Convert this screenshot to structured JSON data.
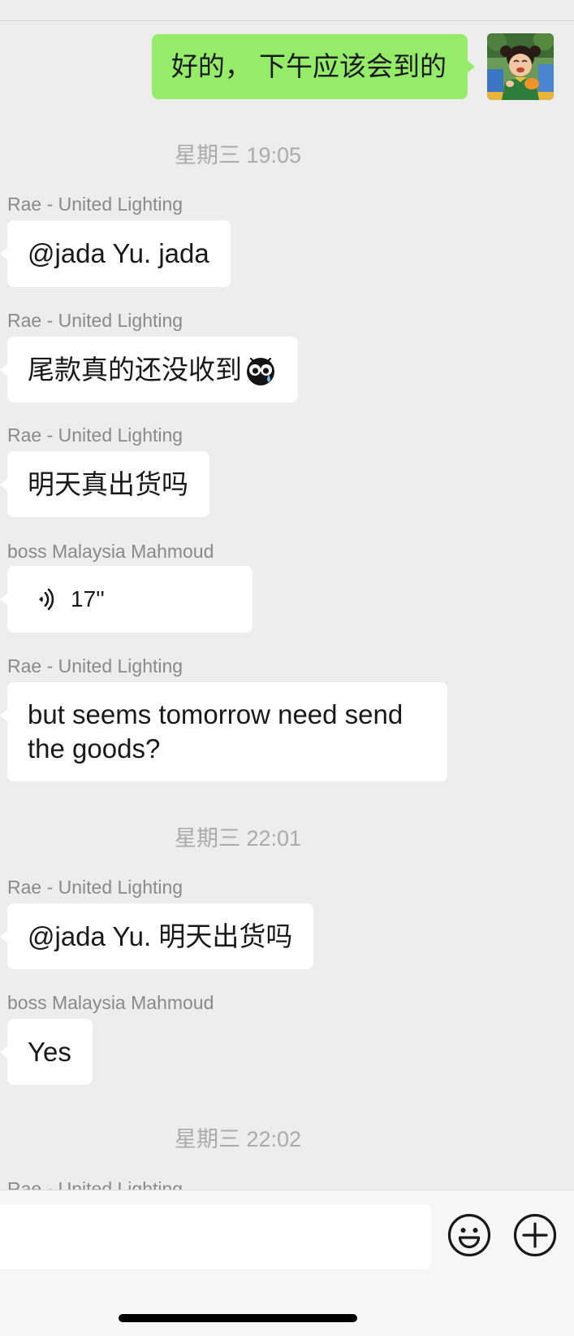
{
  "colors": {
    "chat_background": "#ededed",
    "outgoing_bubble": "#95ec69",
    "incoming_bubble": "#ffffff",
    "sender_name": "#8a8a8a",
    "timestamp": "#ababab"
  },
  "messages": [
    {
      "text": "好的， 下午应该会到的",
      "avatar_icon": "user-avatar"
    },
    {
      "timestamp": "星期三 19:05"
    },
    {
      "sender": "Rae - United Lighting",
      "text": "@jada Yu. jada"
    },
    {
      "sender": "Rae - United Lighting",
      "text": "尾款真的还没收到",
      "emoji_icon": "crying-face-emoji-icon"
    },
    {
      "sender": "Rae - United Lighting",
      "text": "明天真出货吗"
    },
    {
      "sender": "boss Malaysia Mahmoud",
      "voice_duration": "17''",
      "voice_icon": "voice-wave-icon"
    },
    {
      "sender": "Rae - United Lighting",
      "text": "but seems tomorrow need send the goods?"
    },
    {
      "timestamp": "星期三 22:01"
    },
    {
      "sender": "Rae - United Lighting",
      "text": "@jada Yu. 明天出货吗"
    },
    {
      "sender": "boss Malaysia Mahmoud",
      "text": "Yes"
    },
    {
      "timestamp": "星期三 22:02"
    },
    {
      "sender": "Rae - United Lighting"
    }
  ],
  "input_bar": {
    "value": "",
    "emoji_button_icon": "smiley-icon",
    "more_button_icon": "plus-circle-icon"
  }
}
